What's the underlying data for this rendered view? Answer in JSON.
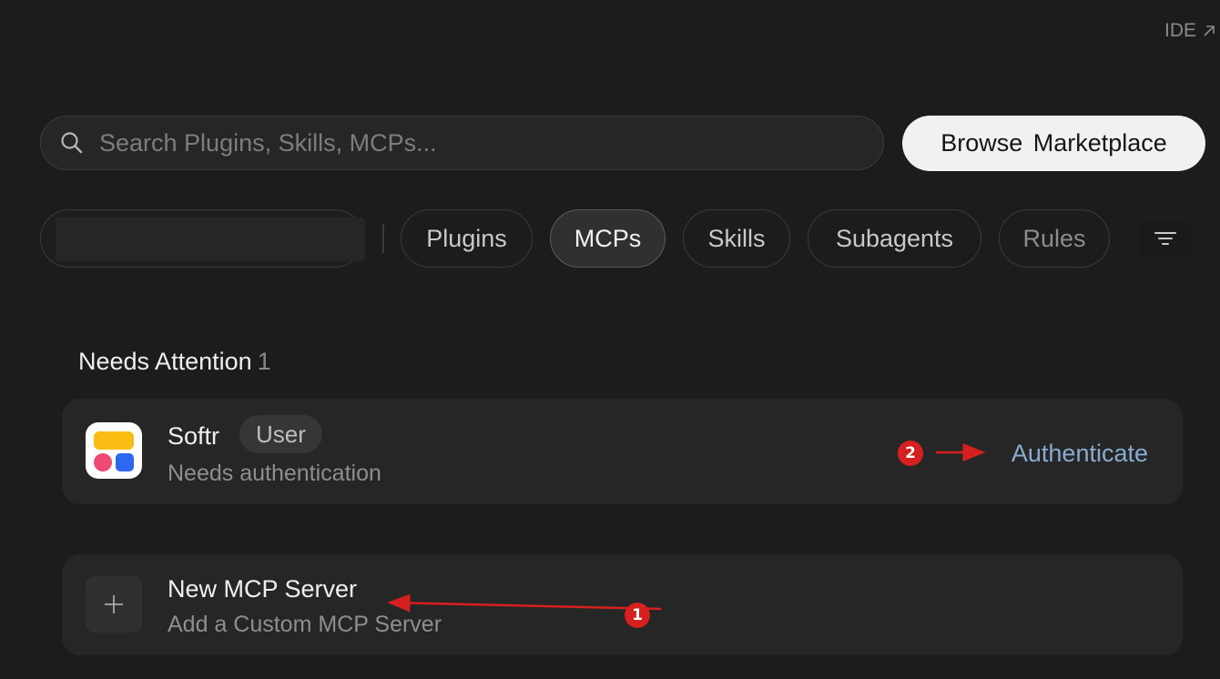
{
  "header": {
    "ide_label": "IDE"
  },
  "search": {
    "placeholder": "Search Plugins, Skills, MCPs..."
  },
  "browse_button": "Browse  Marketplace",
  "tabs": [
    {
      "label": "Plugins",
      "active": false
    },
    {
      "label": "MCPs",
      "active": true
    },
    {
      "label": "Skills",
      "active": false
    },
    {
      "label": "Subagents",
      "active": false
    },
    {
      "label": "Rules",
      "active": false
    }
  ],
  "section": {
    "title": "Needs Attention",
    "count": "1"
  },
  "softr_card": {
    "name": "Softr",
    "badge": "User",
    "subtitle": "Needs authentication",
    "action": "Authenticate"
  },
  "new_server_card": {
    "title": "New MCP Server",
    "subtitle": "Add a Custom MCP Server"
  },
  "annotations": [
    {
      "number": "1",
      "color": "#d61f1f"
    },
    {
      "number": "2",
      "color": "#d61f1f"
    }
  ],
  "colors": {
    "background": "#1c1c1c",
    "card": "#262626",
    "link_blue": "#8aabd0",
    "annotation_red": "#d61f1f"
  }
}
